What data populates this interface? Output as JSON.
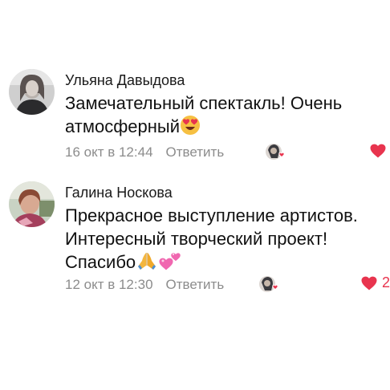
{
  "comments": [
    {
      "author": "Ульяна Давыдова",
      "text_lines": [
        "Замечательный спектакль! Очень",
        "атмосферный"
      ],
      "date": "16 окт в 12:44",
      "reply_label": "Ответить",
      "like_count": ""
    },
    {
      "author": "Галина Носкова",
      "text_lines": [
        "Прекрасное выступление артистов.",
        "Интересный творческий проект!",
        "Спасибо"
      ],
      "date": "12 окт в 12:30",
      "reply_label": "Ответить",
      "like_count": "2"
    }
  ],
  "colors": {
    "like": "#e8344e",
    "meta": "#8c8c8c"
  },
  "icons": [
    "heart-eyes-emoji",
    "praying-hands-emoji",
    "two-hearts-emoji",
    "like-heart-icon"
  ]
}
